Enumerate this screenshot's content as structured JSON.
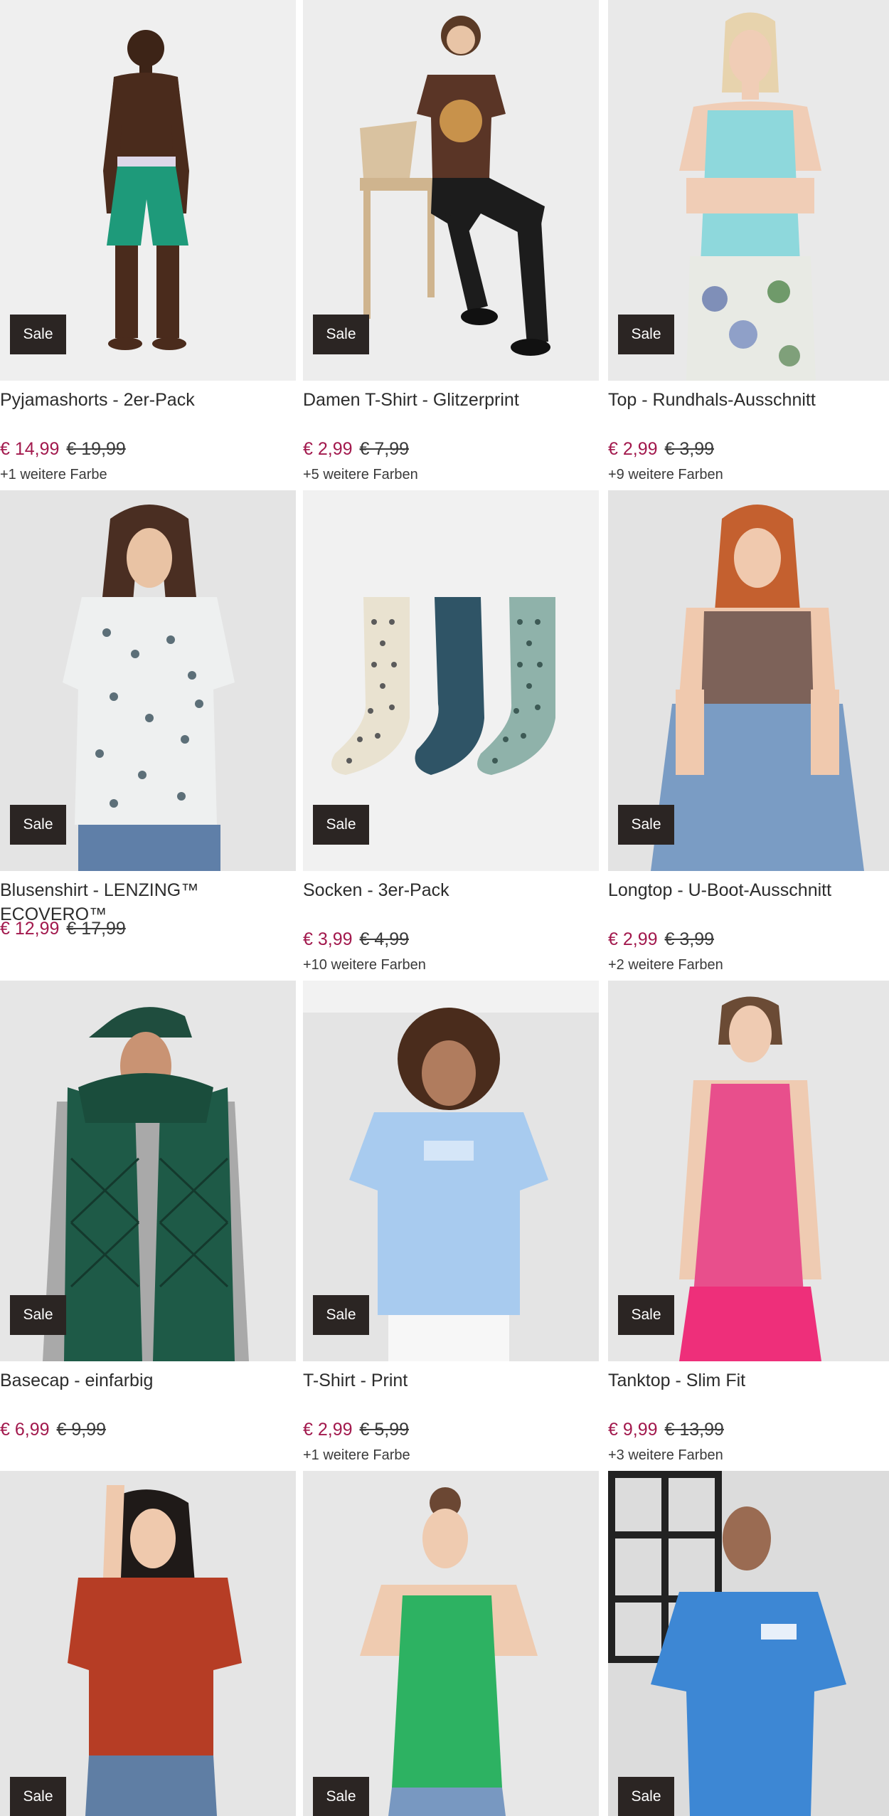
{
  "products": [
    {
      "name": "Pyjamashorts - 2er-Pack",
      "price": "€ 14,99",
      "old_price": "€ 19,99",
      "more": "+1 weitere Farbe",
      "sale": "Sale",
      "image": "man-green-shorts",
      "bg": "#efefef"
    },
    {
      "name": "Damen T-Shirt - Glitzerprint",
      "price": "€ 2,99",
      "old_price": "€ 7,99",
      "more": "+5 weitere Farben",
      "sale": "Sale",
      "image": "woman-brown-tshirt-chair",
      "bg": "#ededed"
    },
    {
      "name": "Top - Rundhals-Ausschnitt",
      "price": "€ 2,99",
      "old_price": "€ 3,99",
      "more": "+9 weitere Farben",
      "sale": "Sale",
      "image": "woman-turquoise-top",
      "bg": "#e9e9e9"
    },
    {
      "name": "Blusenshirt - LENZING™ ECOVERO™",
      "price": "€ 12,99",
      "old_price": "€ 17,99",
      "more": "",
      "sale": "Sale",
      "image": "woman-printed-blouse",
      "bg": "#e4e4e4"
    },
    {
      "name": "Socken - 3er-Pack",
      "price": "€ 3,99",
      "old_price": "€ 4,99",
      "more": "+10 weitere Farben",
      "sale": "Sale",
      "image": "three-socks",
      "bg": "#f1f1f1"
    },
    {
      "name": "Longtop - U-Boot-Ausschnitt",
      "price": "€ 2,99",
      "old_price": "€ 3,99",
      "more": "+2 weitere Farben",
      "sale": "Sale",
      "image": "woman-brown-longtop",
      "bg": "#e3e3e3"
    },
    {
      "name": "Basecap - einfarbig",
      "price": "€ 6,99",
      "old_price": "€ 9,99",
      "more": "",
      "sale": "Sale",
      "image": "woman-green-vest-cap",
      "bg": "#e6e6e6"
    },
    {
      "name": "T-Shirt - Print",
      "price": "€ 2,99",
      "old_price": "€ 5,99",
      "more": "+1 weitere Farbe",
      "sale": "Sale",
      "image": "woman-blue-tshirt",
      "bg": "#e4e4e4"
    },
    {
      "name": "Tanktop - Slim Fit",
      "price": "€ 9,99",
      "old_price": "€ 13,99",
      "more": "+3 weitere Farben",
      "sale": "Sale",
      "image": "woman-pink-tanktop",
      "bg": "#e6e6e6"
    },
    {
      "name": "",
      "price": "",
      "old_price": "",
      "more": "",
      "sale": "Sale",
      "image": "woman-red-blouse",
      "bg": "#e5e5e5"
    },
    {
      "name": "",
      "price": "",
      "old_price": "",
      "more": "",
      "sale": "Sale",
      "image": "woman-green-tanktop",
      "bg": "#e7e7e7"
    },
    {
      "name": "",
      "price": "",
      "old_price": "",
      "more": "",
      "sale": "Sale",
      "image": "man-blue-tshirt",
      "bg": "#dcdcdc"
    }
  ],
  "colors": {
    "sale_bg": "#2b2523",
    "price_sale": "#a2194d",
    "text": "#2c2c2c"
  }
}
